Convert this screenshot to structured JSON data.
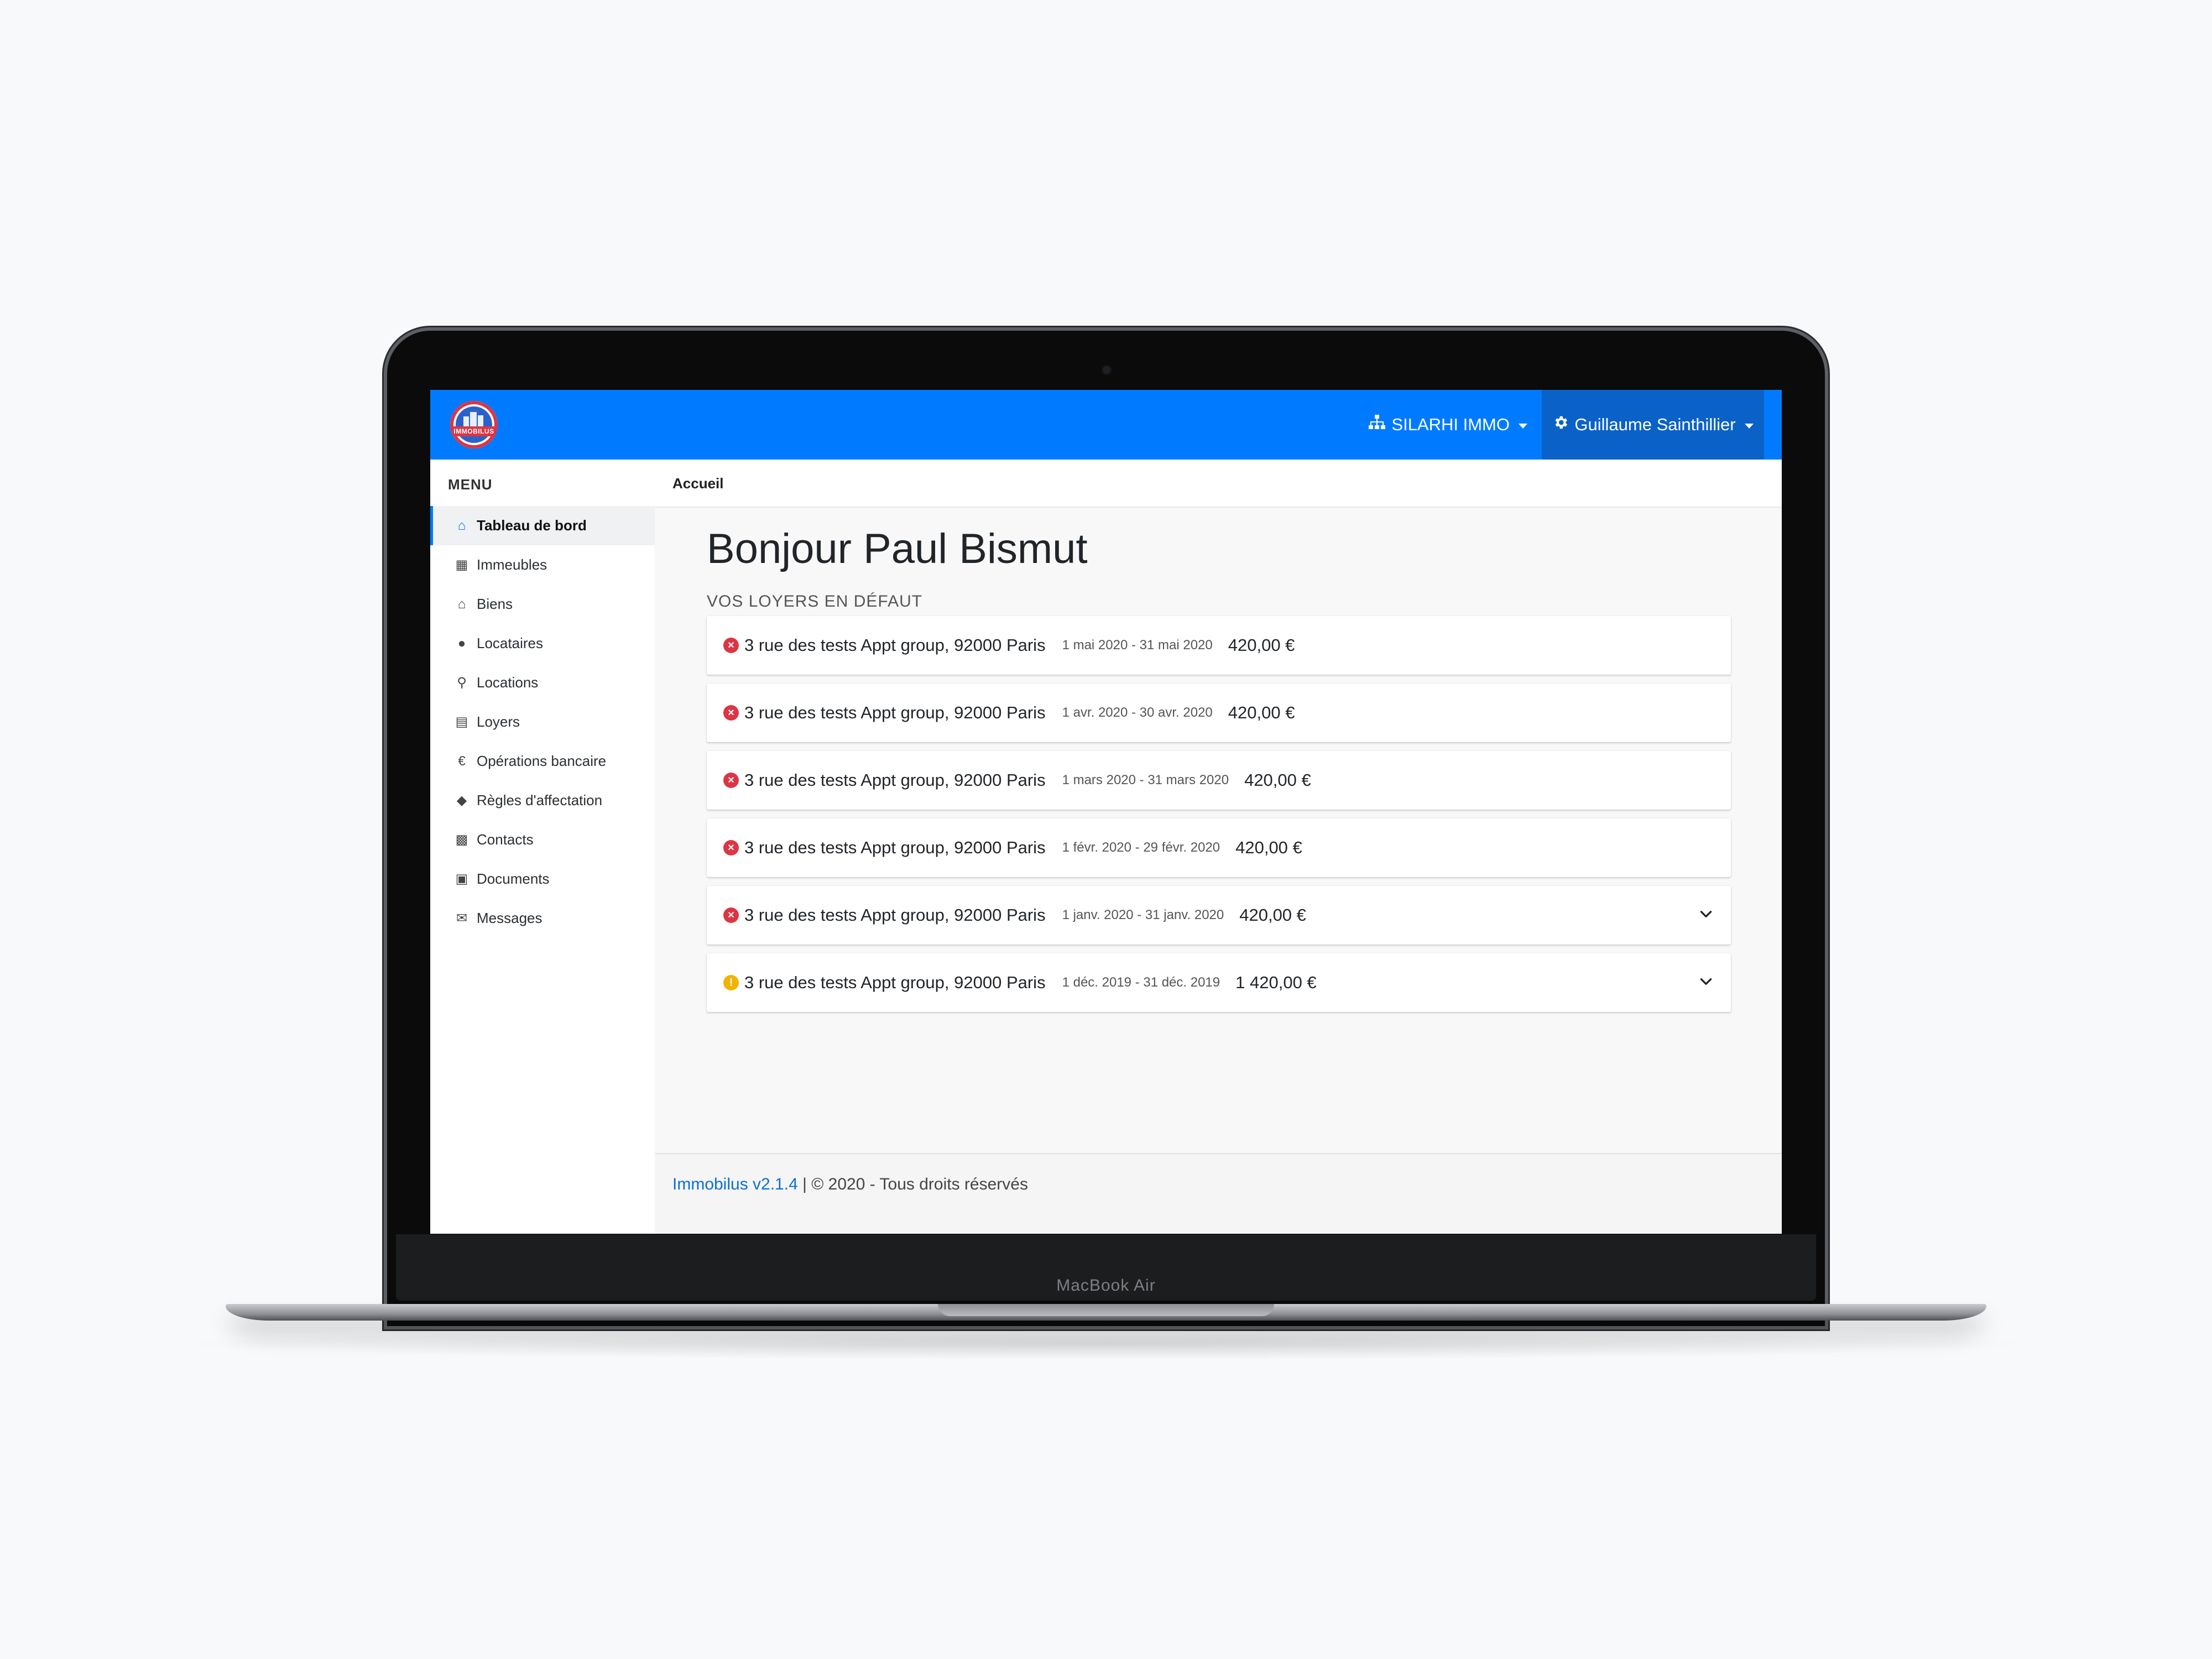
{
  "device": {
    "label": "MacBook Air"
  },
  "topbar": {
    "logo_text": "IMMOBILUS",
    "org_label": "SILARHI IMMO",
    "user_label": "Guillaume Sainthillier"
  },
  "sidebar": {
    "title": "MENU",
    "items": [
      {
        "label": "Tableau de bord",
        "icon": "home-icon",
        "active": true
      },
      {
        "label": "Immeubles",
        "icon": "building-icon"
      },
      {
        "label": "Biens",
        "icon": "house-icon"
      },
      {
        "label": "Locataires",
        "icon": "users-icon"
      },
      {
        "label": "Locations",
        "icon": "key-icon"
      },
      {
        "label": "Loyers",
        "icon": "coins-icon"
      },
      {
        "label": "Opérations bancaire",
        "icon": "euro-icon"
      },
      {
        "label": "Règles d'affectation",
        "icon": "tags-icon"
      },
      {
        "label": "Contacts",
        "icon": "address-card-icon"
      },
      {
        "label": "Documents",
        "icon": "briefcase-icon"
      },
      {
        "label": "Messages",
        "icon": "envelope-icon"
      }
    ]
  },
  "main": {
    "breadcrumb": "Accueil",
    "greeting": "Bonjour Paul Bismut",
    "section_title": "VOS LOYERS EN DÉFAUT",
    "rows": [
      {
        "address": "3 rue des tests Appt group, 92000 Paris",
        "period": "1 mai 2020 - 31 mai 2020",
        "amount": "420,00 €",
        "status": "error",
        "expandable": false
      },
      {
        "address": "3 rue des tests Appt group, 92000 Paris",
        "period": "1 avr. 2020 - 30 avr. 2020",
        "amount": "420,00 €",
        "status": "error",
        "expandable": false
      },
      {
        "address": "3 rue des tests Appt group, 92000 Paris",
        "period": "1 mars 2020 - 31 mars 2020",
        "amount": "420,00 €",
        "status": "error",
        "expandable": false
      },
      {
        "address": "3 rue des tests Appt group, 92000 Paris",
        "period": "1 févr. 2020 - 29 févr. 2020",
        "amount": "420,00 €",
        "status": "error",
        "expandable": false
      },
      {
        "address": "3 rue des tests Appt group, 92000 Paris",
        "period": "1 janv. 2020 - 31 janv. 2020",
        "amount": "420,00 €",
        "status": "error",
        "expandable": true
      },
      {
        "address": "3 rue des tests Appt group, 92000 Paris",
        "period": "1 déc. 2019 - 31 déc. 2019",
        "amount": "1 420,00 €",
        "status": "warning",
        "expandable": true
      }
    ]
  },
  "footer": {
    "link": "Immobilus v2.1.4",
    "text": " | © 2020 - Tous droits réservés"
  },
  "colors": {
    "primary": "#007bff",
    "error": "#dc3545",
    "warning": "#f0b400"
  }
}
